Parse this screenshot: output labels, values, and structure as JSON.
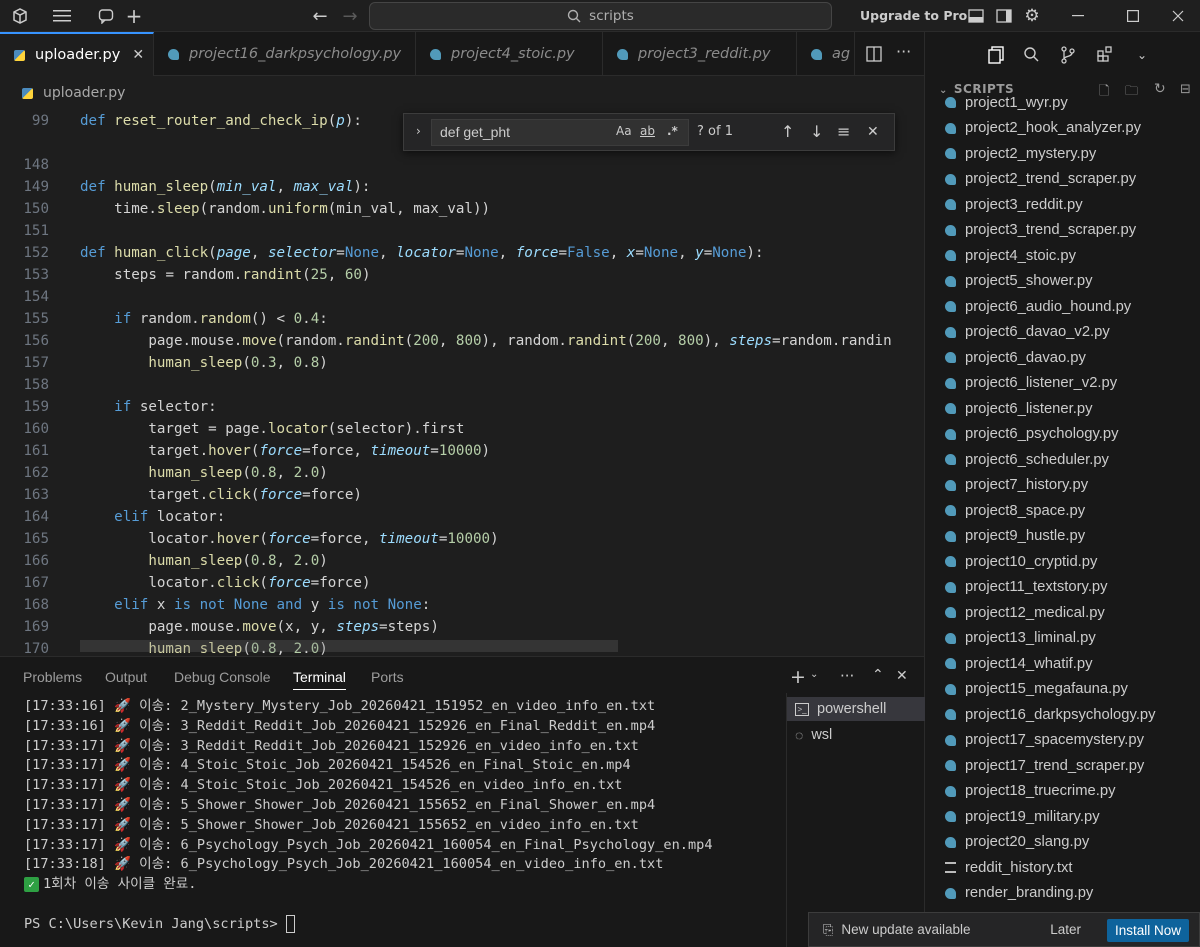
{
  "titlebar": {
    "search_placeholder": "scripts",
    "upgrade_label": "Upgrade to Pro"
  },
  "tabs": [
    {
      "label": "uploader.py"
    },
    {
      "label": "project16_darkpsychology.py"
    },
    {
      "label": "project4_stoic.py"
    },
    {
      "label": "project3_reddit.py"
    },
    {
      "label": "ag"
    }
  ],
  "breadcrumb": {
    "file": "uploader.py"
  },
  "find": {
    "query": "def get_pht",
    "match_case": "Aa",
    "whole_word": "ab",
    "regex": ".*",
    "count": "? of 1"
  },
  "editor": {
    "lines": [
      {
        "n": "99",
        "code": "def reset_router_and_check_ip(p):"
      },
      {
        "n": "148",
        "code": ""
      },
      {
        "n": "149",
        "code": "def human_sleep(min_val, max_val):"
      },
      {
        "n": "150",
        "code": "    time.sleep(random.uniform(min_val, max_val))"
      },
      {
        "n": "151",
        "code": ""
      },
      {
        "n": "152",
        "code": "def human_click(page, selector=None, locator=None, force=False, x=None, y=None):"
      },
      {
        "n": "153",
        "code": "    steps = random.randint(25, 60)"
      },
      {
        "n": "154",
        "code": ""
      },
      {
        "n": "155",
        "code": "    if random.random() < 0.4:"
      },
      {
        "n": "156",
        "code": "        page.mouse.move(random.randint(200, 800), random.randint(200, 800), steps=random.randin"
      },
      {
        "n": "157",
        "code": "        human_sleep(0.3, 0.8)"
      },
      {
        "n": "158",
        "code": ""
      },
      {
        "n": "159",
        "code": "    if selector:"
      },
      {
        "n": "160",
        "code": "        target = page.locator(selector).first"
      },
      {
        "n": "161",
        "code": "        target.hover(force=force, timeout=10000)"
      },
      {
        "n": "162",
        "code": "        human_sleep(0.8, 2.0)"
      },
      {
        "n": "163",
        "code": "        target.click(force=force)"
      },
      {
        "n": "164",
        "code": "    elif locator:"
      },
      {
        "n": "165",
        "code": "        locator.hover(force=force, timeout=10000)"
      },
      {
        "n": "166",
        "code": "        human_sleep(0.8, 2.0)"
      },
      {
        "n": "167",
        "code": "        locator.click(force=force)"
      },
      {
        "n": "168",
        "code": "    elif x is not None and y is not None:"
      },
      {
        "n": "169",
        "code": "        page.mouse.move(x, y, steps=steps)"
      },
      {
        "n": "170",
        "code": "        human_sleep(0.8, 2.0)"
      }
    ]
  },
  "sidebar": {
    "section_title": "SCRIPTS",
    "files": [
      "project1_wyr.py",
      "project2_hook_analyzer.py",
      "project2_mystery.py",
      "project2_trend_scraper.py",
      "project3_reddit.py",
      "project3_trend_scraper.py",
      "project4_stoic.py",
      "project5_shower.py",
      "project6_audio_hound.py",
      "project6_davao_v2.py",
      "project6_davao.py",
      "project6_listener_v2.py",
      "project6_listener.py",
      "project6_psychology.py",
      "project6_scheduler.py",
      "project7_history.py",
      "project8_space.py",
      "project9_hustle.py",
      "project10_cryptid.py",
      "project11_textstory.py",
      "project12_medical.py",
      "project13_liminal.py",
      "project14_whatif.py",
      "project15_megafauna.py",
      "project16_darkpsychology.py",
      "project17_spacemystery.py",
      "project17_trend_scraper.py",
      "project18_truecrime.py",
      "project19_military.py",
      "project20_slang.py",
      "reddit_history.txt",
      "render_branding.py"
    ]
  },
  "panel": {
    "tabs": [
      "Problems",
      "Output",
      "Debug Console",
      "Terminal",
      "Ports"
    ],
    "terminal_lines": [
      {
        "time": "[17:33:16]",
        "label": "이송:",
        "file": "2_Mystery_Mystery_Job_20260421_151952_en_video_info_en.txt"
      },
      {
        "time": "[17:33:16]",
        "label": "이송:",
        "file": "3_Reddit_Reddit_Job_20260421_152926_en_Final_Reddit_en.mp4"
      },
      {
        "time": "[17:33:17]",
        "label": "이송:",
        "file": "3_Reddit_Reddit_Job_20260421_152926_en_video_info_en.txt"
      },
      {
        "time": "[17:33:17]",
        "label": "이송:",
        "file": "4_Stoic_Stoic_Job_20260421_154526_en_Final_Stoic_en.mp4"
      },
      {
        "time": "[17:33:17]",
        "label": "이송:",
        "file": "4_Stoic_Stoic_Job_20260421_154526_en_video_info_en.txt"
      },
      {
        "time": "[17:33:17]",
        "label": "이송:",
        "file": "5_Shower_Shower_Job_20260421_155652_en_Final_Shower_en.mp4"
      },
      {
        "time": "[17:33:17]",
        "label": "이송:",
        "file": "5_Shower_Shower_Job_20260421_155652_en_video_info_en.txt"
      },
      {
        "time": "[17:33:17]",
        "label": "이송:",
        "file": "6_Psychology_Psych_Job_20260421_160054_en_Final_Psychology_en.mp4"
      },
      {
        "time": "[17:33:18]",
        "label": "이송:",
        "file": "6_Psychology_Psych_Job_20260421_160054_en_video_info_en.txt"
      }
    ],
    "complete_msg": "1회차 이송 사이클 완료.",
    "prompt": "PS C:\\Users\\Kevin Jang\\scripts> ",
    "shells": [
      "powershell",
      "wsl"
    ]
  },
  "toast": {
    "message": "New update available",
    "later": "Later",
    "install": "Install Now"
  }
}
